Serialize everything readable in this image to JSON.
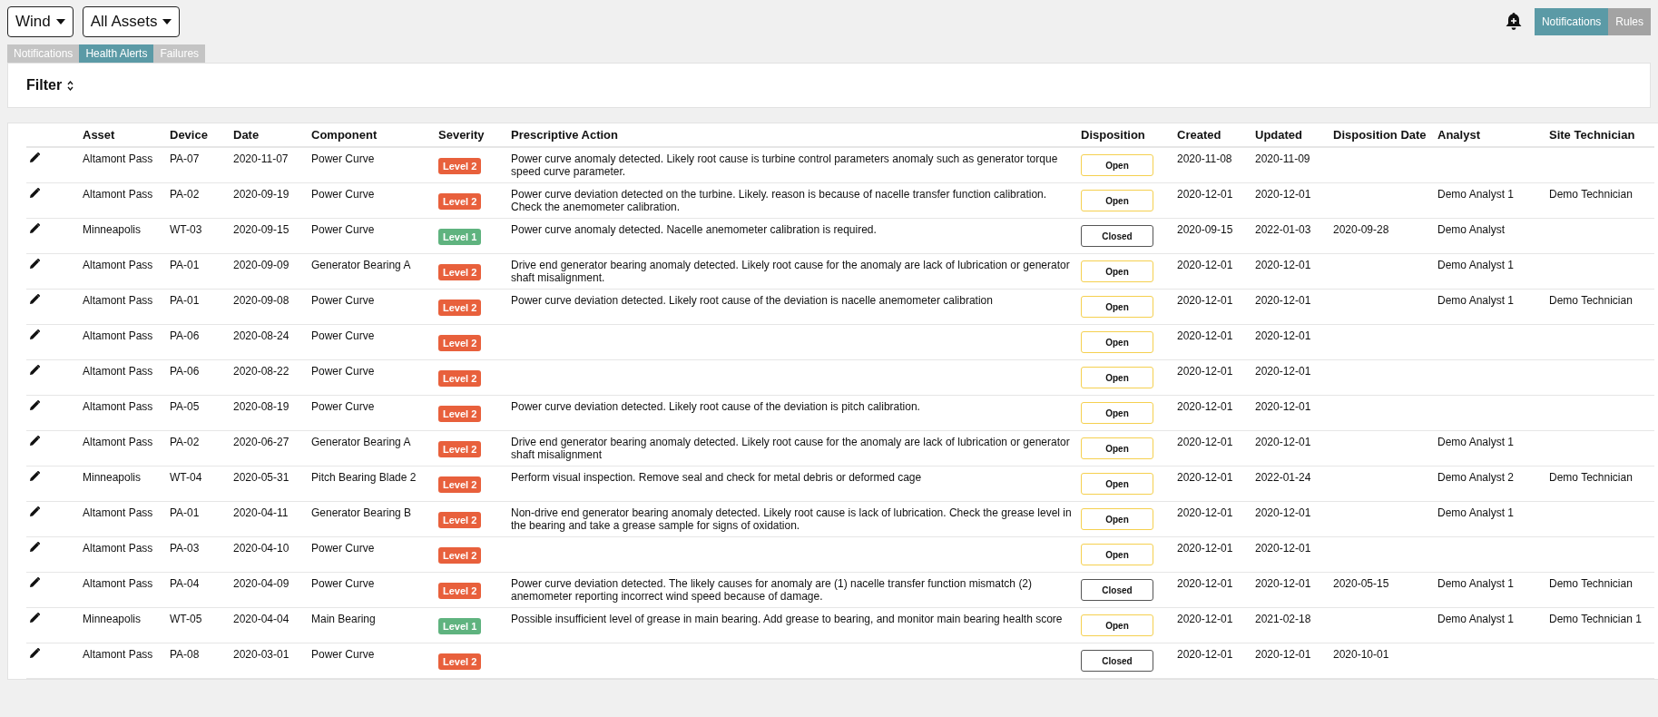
{
  "selectors": [
    {
      "label": "Wind"
    },
    {
      "label": "All Assets"
    }
  ],
  "view_toggle": [
    {
      "label": "Notifications",
      "selected": true
    },
    {
      "label": "Rules",
      "selected": false
    }
  ],
  "tabs": [
    {
      "label": "Notifications",
      "selected": false
    },
    {
      "label": "Health Alerts",
      "selected": true
    },
    {
      "label": "Failures",
      "selected": false
    }
  ],
  "filter": {
    "label": "Filter"
  },
  "table": {
    "columns": [
      "Asset",
      "Device",
      "Date",
      "Component",
      "Severity",
      "Prescriptive Action",
      "Disposition",
      "Created",
      "Updated",
      "Disposition Date",
      "Analyst",
      "Site Technician"
    ],
    "rows": [
      {
        "asset": "Altamont Pass",
        "device": "PA-07",
        "date": "2020-11-07",
        "component": "Power Curve",
        "severity": {
          "label": "Level 2",
          "color": "#e8603c"
        },
        "action": "Power curve anomaly detected. Likely root cause is turbine control parameters anomaly such as generator torque speed curve parameter.",
        "disposition": {
          "label": "Open",
          "kind": "open"
        },
        "created": "2020-11-08",
        "updated": "2020-11-09"
      },
      {
        "asset": "Altamont Pass",
        "device": "PA-02",
        "date": "2020-09-19",
        "component": "Power Curve",
        "severity": {
          "label": "Level 2",
          "color": "#e8603c"
        },
        "action": "Power curve deviation detected on the turbine. Likely. reason is because of nacelle transfer function calibration. Check the anemometer calibration.",
        "disposition": {
          "label": "Open",
          "kind": "open"
        },
        "created": "2020-12-01",
        "updated": "2020-12-01",
        "analyst": "Demo Analyst 1",
        "technician": "Demo Technician"
      },
      {
        "asset": "Minneapolis",
        "device": "WT-03",
        "date": "2020-09-15",
        "component": "Power Curve",
        "severity": {
          "label": "Level 1",
          "color": "#5fb37f"
        },
        "action": "Power curve anomaly detected. Nacelle anemometer calibration is required.",
        "disposition": {
          "label": "Closed",
          "kind": "closed"
        },
        "created": "2020-09-15",
        "updated": "2022-01-03",
        "disposition_date": "2020-09-28",
        "analyst": "Demo Analyst"
      },
      {
        "asset": "Altamont Pass",
        "device": "PA-01",
        "date": "2020-09-09",
        "component": "Generator Bearing A",
        "severity": {
          "label": "Level 2",
          "color": "#e8603c"
        },
        "action": "Drive end generator bearing anomaly detected. Likely root cause for the anomaly are lack of lubrication or generator shaft misalignment.",
        "disposition": {
          "label": "Open",
          "kind": "open"
        },
        "created": "2020-12-01",
        "updated": "2020-12-01",
        "analyst": "Demo Analyst 1"
      },
      {
        "asset": "Altamont Pass",
        "device": "PA-01",
        "date": "2020-09-08",
        "component": "Power Curve",
        "severity": {
          "label": "Level 2",
          "color": "#e8603c"
        },
        "action": "Power curve deviation detected. Likely root cause of the deviation is nacelle anemometer calibration",
        "disposition": {
          "label": "Open",
          "kind": "open"
        },
        "created": "2020-12-01",
        "updated": "2020-12-01",
        "analyst": "Demo Analyst 1",
        "technician": "Demo Technician"
      },
      {
        "asset": "Altamont Pass",
        "device": "PA-06",
        "date": "2020-08-24",
        "component": "Power Curve",
        "severity": {
          "label": "Level 2",
          "color": "#e8603c"
        },
        "disposition": {
          "label": "Open",
          "kind": "open"
        },
        "created": "2020-12-01",
        "updated": "2020-12-01"
      },
      {
        "asset": "Altamont Pass",
        "device": "PA-06",
        "date": "2020-08-22",
        "component": "Power Curve",
        "severity": {
          "label": "Level 2",
          "color": "#e8603c"
        },
        "disposition": {
          "label": "Open",
          "kind": "open"
        },
        "created": "2020-12-01",
        "updated": "2020-12-01"
      },
      {
        "asset": "Altamont Pass",
        "device": "PA-05",
        "date": "2020-08-19",
        "component": "Power Curve",
        "severity": {
          "label": "Level 2",
          "color": "#e8603c"
        },
        "action": "Power curve deviation detected. Likely root cause of the deviation is pitch calibration.",
        "disposition": {
          "label": "Open",
          "kind": "open"
        },
        "created": "2020-12-01",
        "updated": "2020-12-01"
      },
      {
        "asset": "Altamont Pass",
        "device": "PA-02",
        "date": "2020-06-27",
        "component": "Generator Bearing A",
        "severity": {
          "label": "Level 2",
          "color": "#e8603c"
        },
        "action": "Drive end generator bearing anomaly detected. Likely root cause for the anomaly are lack of lubrication or generator shaft misalignment",
        "disposition": {
          "label": "Open",
          "kind": "open"
        },
        "created": "2020-12-01",
        "updated": "2020-12-01",
        "analyst": "Demo Analyst 1"
      },
      {
        "asset": "Minneapolis",
        "device": "WT-04",
        "date": "2020-05-31",
        "component": "Pitch Bearing Blade 2",
        "severity": {
          "label": "Level 2",
          "color": "#e8603c"
        },
        "action": "Perform visual inspection. Remove seal and check for metal debris or deformed cage",
        "disposition": {
          "label": "Open",
          "kind": "open"
        },
        "created": "2020-12-01",
        "updated": "2022-01-24",
        "analyst": "Demo Analyst 2",
        "technician": "Demo Technician"
      },
      {
        "asset": "Altamont Pass",
        "device": "PA-01",
        "date": "2020-04-11",
        "component": "Generator Bearing B",
        "severity": {
          "label": "Level 2",
          "color": "#e8603c"
        },
        "action": "Non-drive end generator bearing anomaly detected. Likely root cause is lack of lubrication. Check the grease level in the bearing and take a grease sample for signs of oxidation.",
        "disposition": {
          "label": "Open",
          "kind": "open"
        },
        "created": "2020-12-01",
        "updated": "2020-12-01",
        "analyst": "Demo Analyst 1"
      },
      {
        "asset": "Altamont Pass",
        "device": "PA-03",
        "date": "2020-04-10",
        "component": "Power Curve",
        "severity": {
          "label": "Level 2",
          "color": "#e8603c"
        },
        "disposition": {
          "label": "Open",
          "kind": "open"
        },
        "created": "2020-12-01",
        "updated": "2020-12-01"
      },
      {
        "asset": "Altamont Pass",
        "device": "PA-04",
        "date": "2020-04-09",
        "component": "Power Curve",
        "severity": {
          "label": "Level 2",
          "color": "#e8603c"
        },
        "action": "Power curve deviation detected. The likely causes for anomaly are (1) nacelle transfer function mismatch (2) anemometer reporting incorrect wind speed because of damage.",
        "disposition": {
          "label": "Closed",
          "kind": "closed"
        },
        "created": "2020-12-01",
        "updated": "2020-12-01",
        "disposition_date": "2020-05-15",
        "analyst": "Demo Analyst 1",
        "technician": "Demo Technician"
      },
      {
        "asset": "Minneapolis",
        "device": "WT-05",
        "date": "2020-04-04",
        "component": "Main Bearing",
        "severity": {
          "label": "Level 1",
          "color": "#5fb37f"
        },
        "action": "Possible insufficient level of grease in main bearing. Add grease to bearing, and monitor main bearing health score",
        "disposition": {
          "label": "Open",
          "kind": "open"
        },
        "created": "2020-12-01",
        "updated": "2021-02-18",
        "analyst": "Demo Analyst 1",
        "technician": "Demo Technician 1"
      },
      {
        "asset": "Altamont Pass",
        "device": "PA-08",
        "date": "2020-03-01",
        "component": "Power Curve",
        "severity": {
          "label": "Level 2",
          "color": "#e8603c"
        },
        "disposition": {
          "label": "Closed",
          "kind": "closed"
        },
        "created": "2020-12-01",
        "updated": "2020-12-01",
        "disposition_date": "2020-10-01"
      }
    ]
  }
}
